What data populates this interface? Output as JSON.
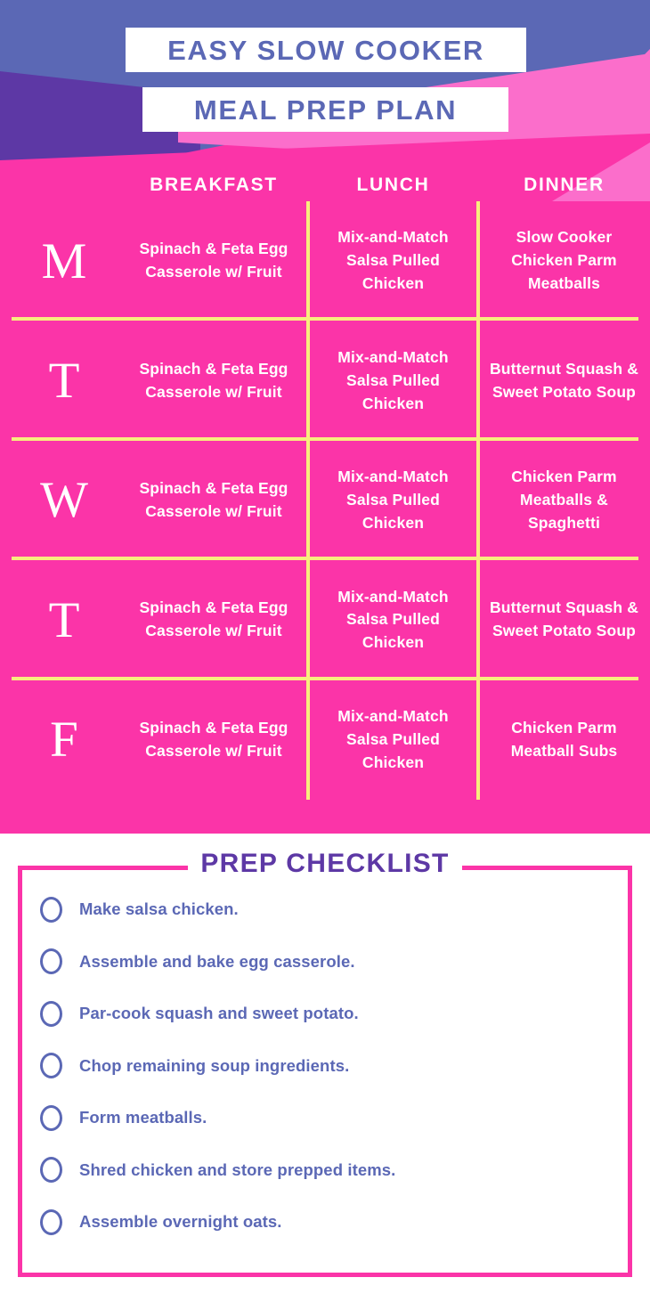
{
  "colors": {
    "blue_purple": "#5b68b5",
    "deep_purple": "#5d38a5",
    "hot_pink": "#fb34a8",
    "light_pink": "#fb6ecb",
    "yellow": "#f8ed7e",
    "white": "#ffffff"
  },
  "header": {
    "title_line_1": "EASY SLOW COOKER",
    "title_line_2": "MEAL PREP PLAN"
  },
  "table": {
    "columns": [
      "BREAKFAST",
      "LUNCH",
      "DINNER"
    ],
    "rows": [
      {
        "day": "M",
        "breakfast": "Spinach & Feta Egg Casserole w/ Fruit",
        "lunch": "Mix-and-Match Salsa Pulled Chicken",
        "dinner": "Slow Cooker Chicken Parm Meatballs"
      },
      {
        "day": "T",
        "breakfast": "Spinach & Feta Egg Casserole w/ Fruit",
        "lunch": "Mix-and-Match Salsa Pulled Chicken",
        "dinner": "Butternut Squash & Sweet Potato Soup"
      },
      {
        "day": "W",
        "breakfast": "Spinach & Feta Egg Casserole w/ Fruit",
        "lunch": "Mix-and-Match Salsa Pulled Chicken",
        "dinner": "Chicken Parm Meatballs & Spaghetti"
      },
      {
        "day": "T",
        "breakfast": "Spinach & Feta Egg Casserole w/ Fruit",
        "lunch": "Mix-and-Match Salsa Pulled Chicken",
        "dinner": "Butternut Squash & Sweet Potato Soup"
      },
      {
        "day": "F",
        "breakfast": "Spinach & Feta Egg Casserole w/ Fruit",
        "lunch": "Mix-and-Match Salsa Pulled Chicken",
        "dinner": "Chicken Parm Meatball Subs"
      }
    ]
  },
  "checklist": {
    "title": "PREP CHECKLIST",
    "items": [
      "Make salsa chicken.",
      "Assemble and bake egg casserole.",
      "Par-cook squash and sweet potato.",
      "Chop remaining soup ingredients.",
      "Form meatballs.",
      "Shred chicken and store prepped items.",
      "Assemble overnight oats."
    ]
  }
}
